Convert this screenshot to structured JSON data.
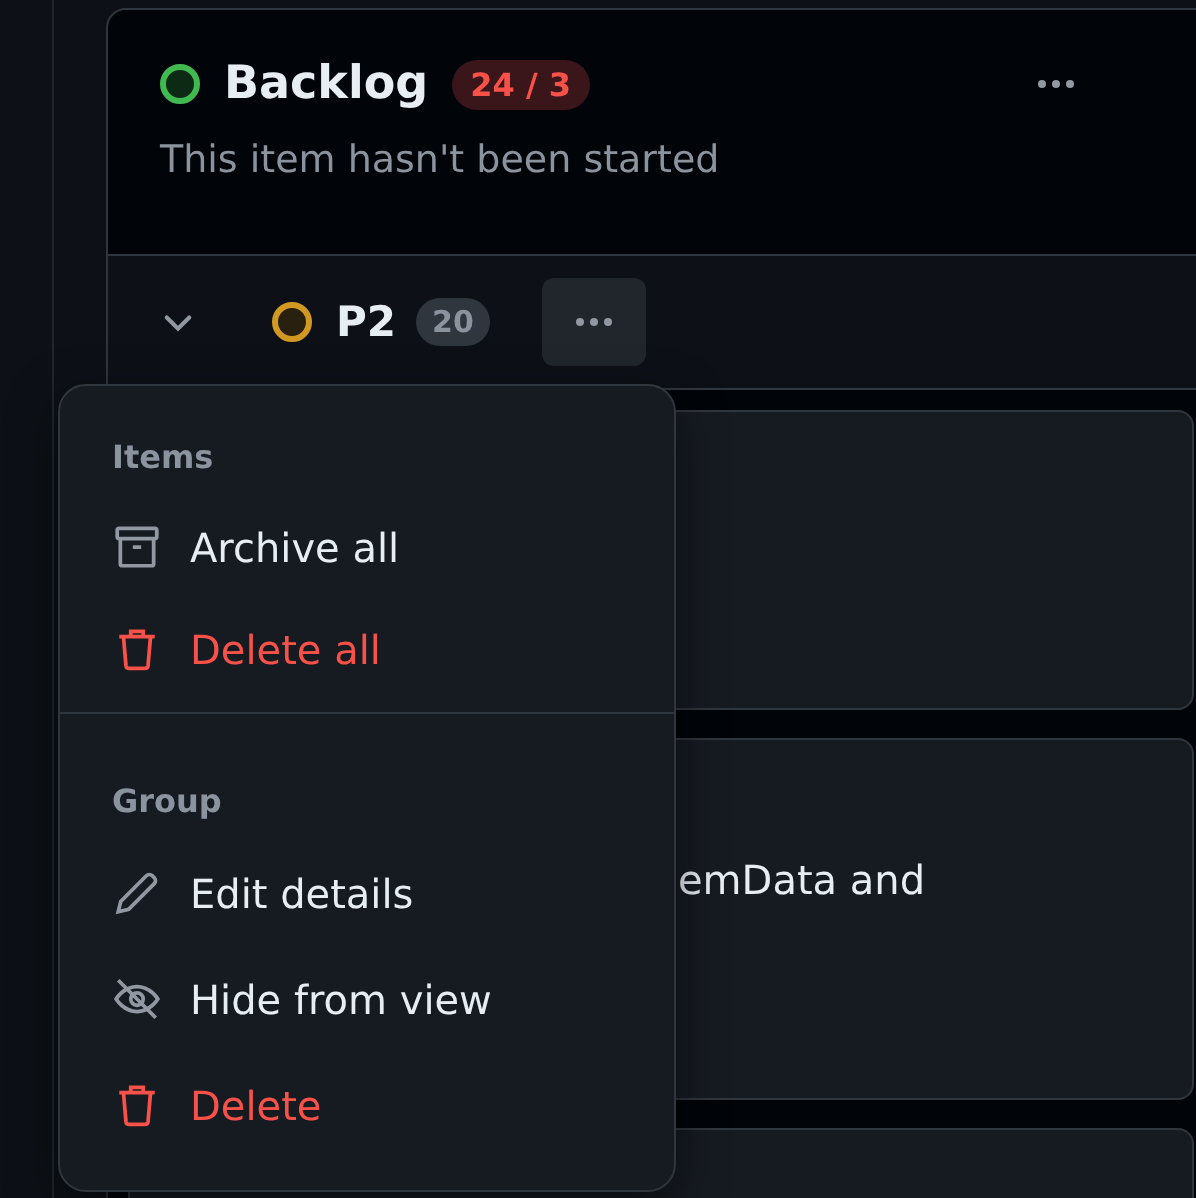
{
  "column": {
    "title": "Backlog",
    "color": "#3fb950",
    "count": "24 / 3",
    "over_limit": true,
    "description": "This item hasn't been started"
  },
  "group": {
    "name": "P2",
    "color": "#d29922",
    "count": "20",
    "expanded": true
  },
  "cards": [
    {
      "kind": "blank"
    },
    {
      "kind": "text",
      "text": "emData and"
    },
    {
      "kind": "blank"
    }
  ],
  "menu": {
    "sections": [
      {
        "title": "Items",
        "items": [
          {
            "kind": "archive",
            "label": "Archive all",
            "danger": false
          },
          {
            "kind": "trash",
            "label": "Delete all",
            "danger": true
          }
        ]
      },
      {
        "title": "Group",
        "items": [
          {
            "kind": "pencil",
            "label": "Edit details",
            "danger": false
          },
          {
            "kind": "eye-off",
            "label": "Hide from view",
            "danger": false
          },
          {
            "kind": "trash",
            "label": "Delete",
            "danger": true
          }
        ]
      }
    ]
  }
}
